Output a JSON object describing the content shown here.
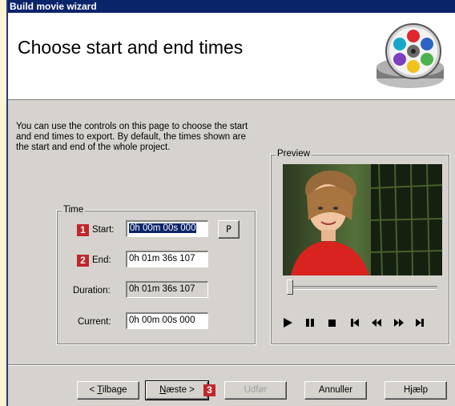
{
  "window": {
    "title": "Build movie wizard"
  },
  "header": {
    "title": "Choose start and end times",
    "icon": "film-reel-icon"
  },
  "description": "You can use the controls on this page to choose the start and end times to export. By default, the times shown are the start and end of the whole project.",
  "time_group": {
    "legend": "Time",
    "start": {
      "badge": "1",
      "label": "Start:",
      "value": "0h 00m 00s 000"
    },
    "set_button": "P",
    "end": {
      "badge": "2",
      "label": "End:",
      "value": "0h 01m 36s 107"
    },
    "duration": {
      "label": "Duration:",
      "value": "0h 01m 36s 107"
    },
    "current": {
      "label": "Current:",
      "value": "0h 00m 00s 000"
    }
  },
  "preview_group": {
    "legend": "Preview",
    "scrubber_position": 0,
    "controls": [
      "play-icon",
      "pause-icon",
      "stop-icon",
      "skip-to-start-icon",
      "rewind-icon",
      "fast-forward-icon",
      "skip-to-end-icon"
    ]
  },
  "footer": {
    "back": {
      "prefix": "< ",
      "mnemonic": "T",
      "rest": "ilbage"
    },
    "next": {
      "mnemonic": "N",
      "rest": "æste >",
      "badge": "3"
    },
    "finish": "Udfør",
    "cancel": "Annuller",
    "help": "Hjælp"
  },
  "colors": {
    "titlebar": "#0a246a",
    "badge": "#c0272d",
    "face": "#d6d3ce"
  }
}
